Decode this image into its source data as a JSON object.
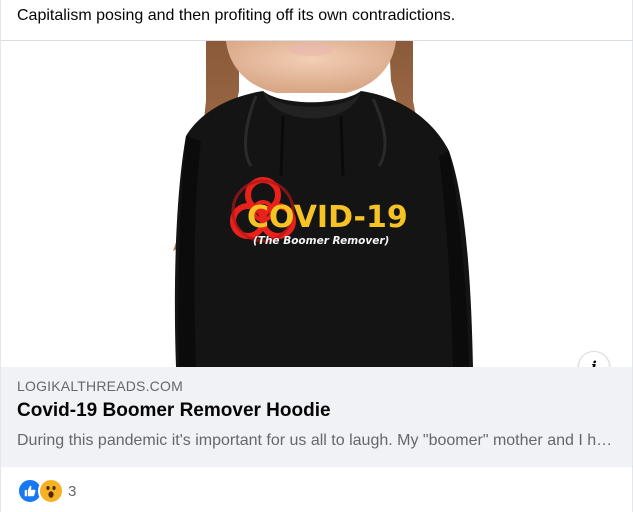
{
  "post": {
    "text": "Capitalism posing and then profiting off its own contradictions."
  },
  "link_card": {
    "image": {
      "shirt_text": "COVID-19",
      "shirt_subtext": "(The Boomer Remover)"
    },
    "info_icon": "i",
    "domain": "LOGIKALTHREADS.COM",
    "title": "Covid-19 Boomer Remover Hoodie",
    "description": "During this pandemic it's important for us all to laugh. My \"boomer\" mother and I have been having a great time with this hoodie."
  },
  "reactions": {
    "icons": [
      "like-icon",
      "wow-icon"
    ],
    "count": "3"
  },
  "colors": {
    "link_meta_bg": "#f0f2f5",
    "like_blue": "#1877f2",
    "wow_yellow": "#f7b125",
    "biohazard_red": "#e8221b",
    "shirt_text_yellow": "#f6c324"
  }
}
